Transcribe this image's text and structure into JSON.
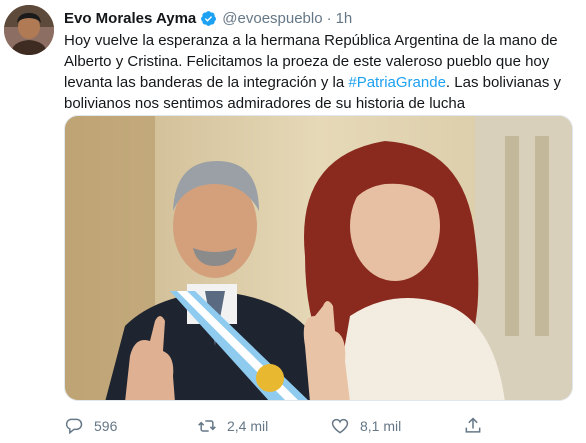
{
  "author": {
    "name": "Evo Morales Ayma",
    "handle": "@evoespueblo",
    "separator": "·",
    "time": "1h",
    "avatar_icon": "profile-photo",
    "verified_icon": "verified-badge-icon"
  },
  "tweet": {
    "text_before": "Hoy vuelve la esperanza a la hermana República Argentina de la mano de Alberto y Cristina. Felicitamos la proeza de este valeroso pueblo que hoy levanta las banderas de la integración y la ",
    "hashtag": "#PatriaGrande",
    "text_after": ". Las bolivianas y bolivianos nos sentimos admiradores de su historia de lucha"
  },
  "media": {
    "description_icon": "attached-photo"
  },
  "actions": {
    "reply_count": "596",
    "retweet_count": "2,4 mil",
    "like_count": "8,1 mil",
    "reply_icon": "reply-icon",
    "retweet_icon": "retweet-icon",
    "like_icon": "heart-icon",
    "share_icon": "share-icon"
  },
  "colors": {
    "text": "#14171a",
    "secondary": "#657786",
    "accent": "#1da1f2"
  }
}
